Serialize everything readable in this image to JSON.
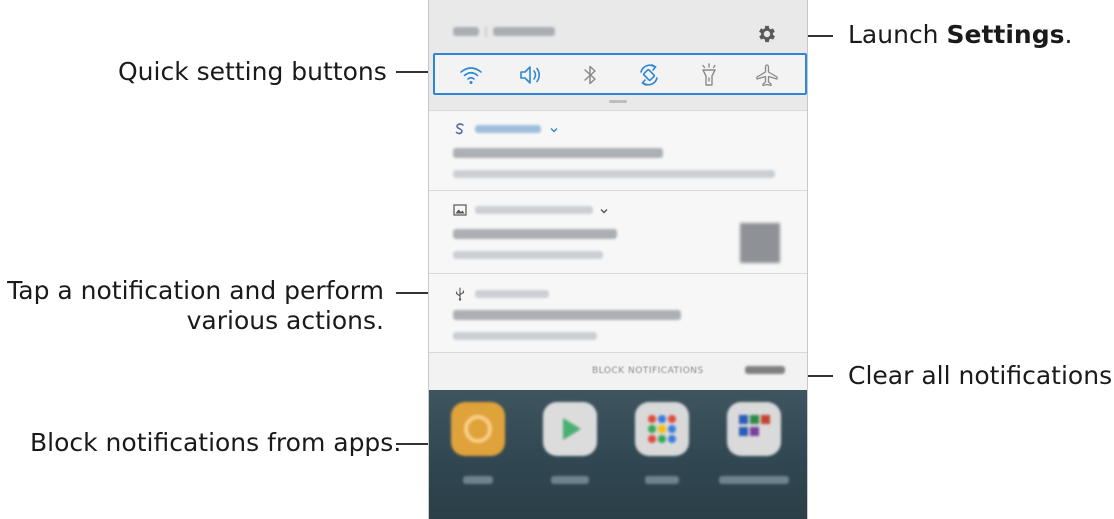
{
  "callouts": {
    "quick_settings": "Quick setting buttons",
    "launch_settings_prefix": "Launch ",
    "launch_settings_bold": "Settings",
    "launch_settings_suffix": ".",
    "tap_notification_line1": "Tap a notification and perform",
    "tap_notification_line2": "various actions.",
    "clear_all": "Clear all notifications.",
    "block_notifications": "Block notifications from apps."
  },
  "panel": {
    "quick_settings": [
      {
        "icon": "wifi-icon",
        "state": "on"
      },
      {
        "icon": "sound-icon",
        "state": "on"
      },
      {
        "icon": "bluetooth-icon",
        "state": "off"
      },
      {
        "icon": "auto-rotate-icon",
        "state": "on"
      },
      {
        "icon": "flashlight-icon",
        "state": "off"
      },
      {
        "icon": "airplane-mode-icon",
        "state": "off"
      }
    ],
    "actions": {
      "block_label": "BLOCK NOTIFICATIONS"
    }
  },
  "colors": {
    "highlight": "#2f86d6",
    "active_icon": "#2f86d6",
    "inactive_icon": "#7a7a7a",
    "home_background": "#34505a"
  }
}
